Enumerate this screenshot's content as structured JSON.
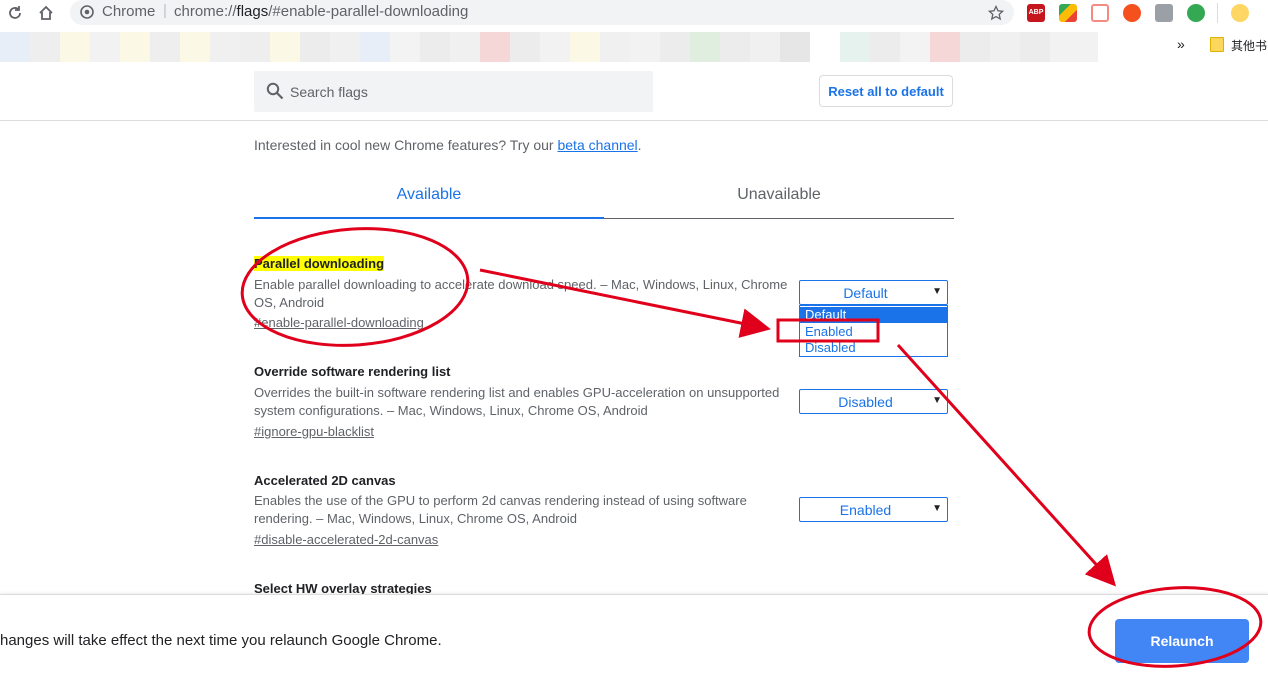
{
  "browser": {
    "omnibox_origin": "Chrome",
    "omnibox_separator": "|",
    "url_prefix": "chrome://",
    "url_host": "flags",
    "url_path": "/#enable-parallel-downloading",
    "extension_abp_label": "ABP",
    "bookmarks_more": "»",
    "bookmarks_folder": "其他书"
  },
  "flags": {
    "search_placeholder": "Search flags",
    "reset_label": "Reset all to default",
    "promo_text": "Interested in cool new Chrome features? Try our ",
    "promo_link": "beta channel",
    "promo_end": ".",
    "tabs": [
      {
        "label": "Available"
      },
      {
        "label": "Unavailable"
      }
    ],
    "experiments": [
      {
        "title": "Parallel downloading",
        "description": "Enable parallel downloading to accelerate download speed. – Mac, Windows, Linux, Chrome OS, Android",
        "link": "#enable-parallel-downloading",
        "value": "Default",
        "options": [
          "Default",
          "Enabled",
          "Disabled"
        ]
      },
      {
        "title": "Override software rendering list",
        "description": "Overrides the built-in software rendering list and enables GPU-acceleration on unsupported system configurations. – Mac, Windows, Linux, Chrome OS, Android",
        "link": "#ignore-gpu-blacklist",
        "value": "Disabled"
      },
      {
        "title": "Accelerated 2D canvas",
        "description": "Enables the use of the GPU to perform 2d canvas rendering instead of using software rendering. – Mac, Windows, Linux, Chrome OS, Android",
        "link": "#disable-accelerated-2d-canvas",
        "value": "Enabled"
      },
      {
        "title": "Select HW overlay strategies"
      }
    ]
  },
  "footer": {
    "message": "hanges will take effect the next time you relaunch Google Chrome.",
    "relaunch_label": "Relaunch"
  },
  "colors": {
    "accent": "#1a73e8",
    "relaunch_button": "#4285f4",
    "highlight": "#ffff00",
    "annotation": "#e0001b"
  }
}
